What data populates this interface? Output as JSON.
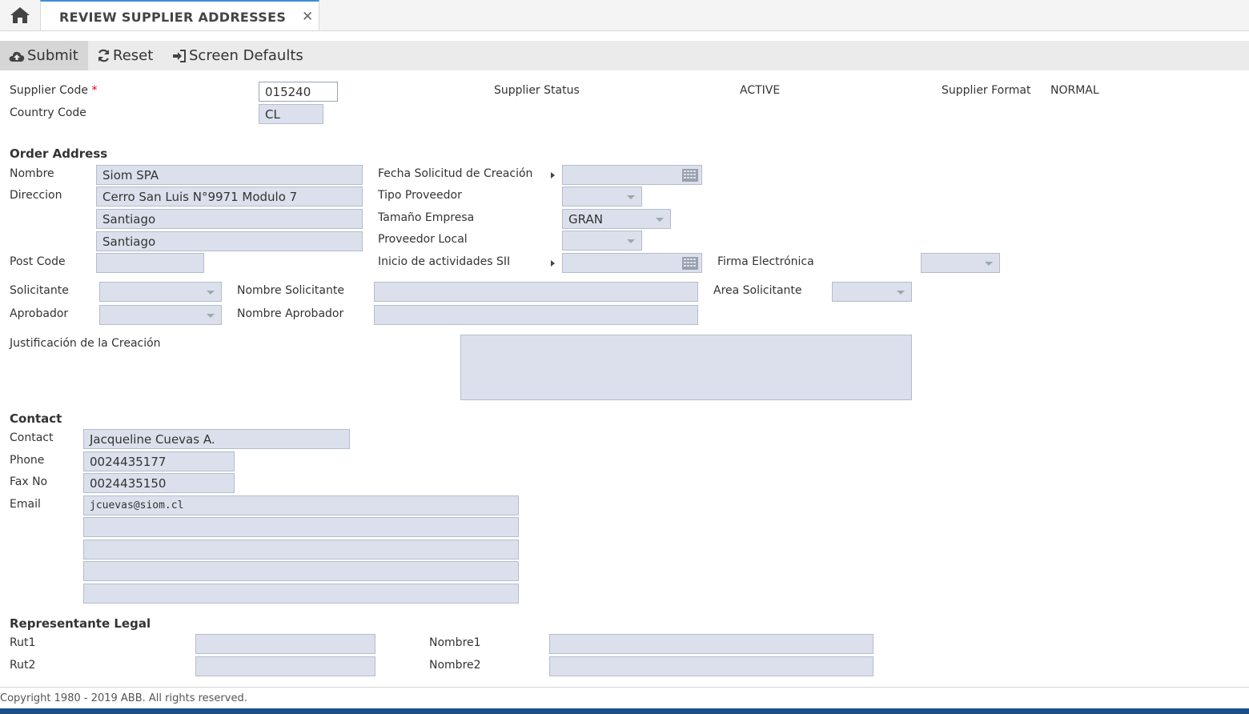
{
  "tab": {
    "title": "REVIEW SUPPLIER ADDRESSES",
    "close": "✕"
  },
  "toolbar": {
    "submit": "Submit",
    "reset": "Reset",
    "defaults": "Screen Defaults"
  },
  "header": {
    "supplier_code_label": "Supplier Code",
    "required_mark": "*",
    "supplier_code_value": "015240",
    "country_code_label": "Country Code",
    "country_code_value": "CL",
    "supplier_status_label": "Supplier Status",
    "supplier_status_value": "ACTIVE",
    "supplier_format_label": "Supplier Format",
    "supplier_format_value": "NORMAL"
  },
  "order_address": {
    "title": "Order Address",
    "nombre_label": "Nombre",
    "nombre_value": "Siom SPA",
    "direccion_label": "Direccion",
    "direccion_lines": [
      "Cerro San Luis N°9971 Modulo 7",
      "Santiago",
      "Santiago"
    ],
    "post_code_label": "Post Code",
    "post_code_value": "",
    "fecha_label": "Fecha Solicitud de Creación",
    "fecha_value": "",
    "tipo_label": "Tipo Proveedor",
    "tipo_value": "",
    "tamano_label": "Tamaño Empresa",
    "tamano_value": "GRAN",
    "local_label": "Proveedor Local",
    "local_value": "",
    "inicio_label": "Inicio de actividades SII",
    "inicio_value": "",
    "firma_label": "Firma Electrónica",
    "firma_value": "",
    "solicitante_label": "Solicitante",
    "nombre_solicitante_label": "Nombre Solicitante",
    "area_label": "Area Solicitante",
    "aprobador_label": "Aprobador",
    "nombre_aprobador_label": "Nombre Aprobador",
    "justificacion_label": "Justificación de la Creación"
  },
  "contact": {
    "title": "Contact",
    "contact_label": "Contact",
    "contact_value": "Jacqueline Cuevas A.",
    "phone_label": "Phone",
    "phone_value": "0024435177",
    "fax_label": "Fax No",
    "fax_value": "0024435150",
    "email_label": "Email",
    "emails": [
      "jcuevas@siom.cl",
      "",
      "",
      "",
      ""
    ]
  },
  "legal": {
    "title": "Representante Legal",
    "rut1_label": "Rut1",
    "rut2_label": "Rut2",
    "nombre1_label": "Nombre1",
    "nombre2_label": "Nombre2"
  },
  "footer": {
    "copyright": "Copyright 1980 - 2019 ABB. All rights reserved."
  },
  "colors": {
    "accent": "#3b8fd6",
    "field_bg": "#dbe0ec",
    "required": "#d0021b"
  }
}
